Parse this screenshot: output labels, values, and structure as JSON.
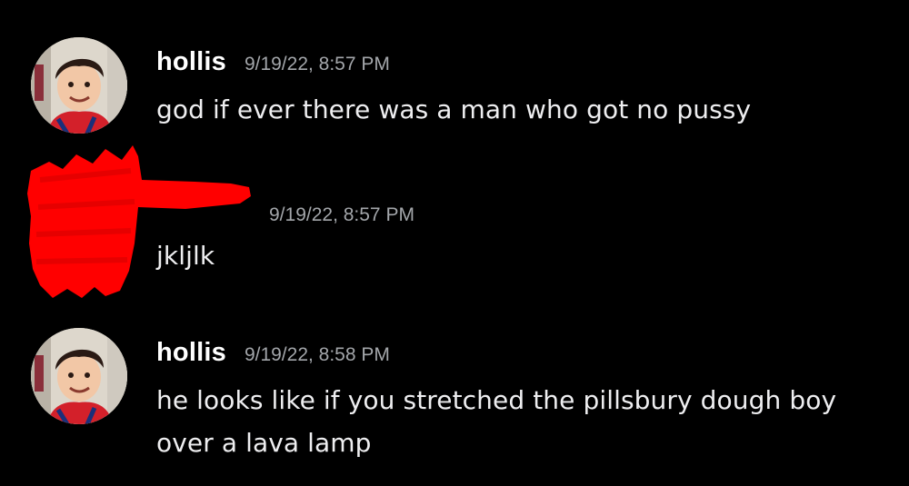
{
  "messages": [
    {
      "author": "hollis",
      "timestamp": "9/19/22, 8:57 PM",
      "text": "god if ever there was a man who got no pussy"
    },
    {
      "author": "",
      "timestamp": "9/19/22, 8:57 PM",
      "text": "jkljlk"
    },
    {
      "author": "hollis",
      "timestamp": "9/19/22, 8:58 PM",
      "text": "he looks like if you stretched the pillsbury dough boy over a lava lamp"
    }
  ],
  "colors": {
    "background": "#000000",
    "username": "#ffffff",
    "timestamp": "#a3a6aa",
    "message_text": "#eeeef0",
    "redaction": "#ff0000"
  },
  "icons": {
    "avatar": "avatar-photo-child-icon",
    "redaction": "red-scribble-redaction"
  }
}
